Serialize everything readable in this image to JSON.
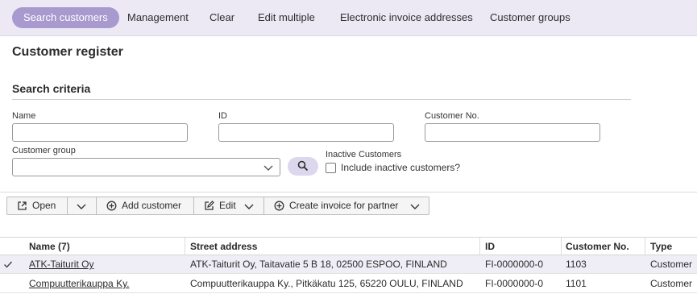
{
  "nav": {
    "tabs": [
      {
        "label": "Search customers",
        "active": true
      },
      {
        "label": "Management"
      },
      {
        "label": "Clear"
      },
      {
        "label": "Edit multiple"
      },
      {
        "label": "Electronic invoice addresses"
      },
      {
        "label": "Customer groups"
      }
    ]
  },
  "page": {
    "title": "Customer register"
  },
  "search": {
    "section_title": "Search criteria",
    "name_label": "Name",
    "name_value": "",
    "id_label": "ID",
    "id_value": "",
    "customer_no_label": "Customer No.",
    "customer_no_value": "",
    "customer_group_label": "Customer group",
    "customer_group_value": "",
    "inactive_label": "Inactive Customers",
    "include_inactive_label": "Include inactive customers?",
    "include_inactive_checked": false
  },
  "toolbar": {
    "open_label": "Open",
    "add_customer_label": "Add customer",
    "edit_label": "Edit",
    "create_invoice_label": "Create invoice for partner"
  },
  "table": {
    "columns": [
      "Name (7)",
      "Street address",
      "ID",
      "Customer No.",
      "Type"
    ],
    "rows": [
      {
        "name": "ATK-Taiturit Oy",
        "address": "ATK-Taiturit Oy, Taitavatie 5 B 18, 02500 ESPOO, FINLAND",
        "id": "FI-0000000-0",
        "customer_no": "1103",
        "type": "Customer",
        "selected": true
      },
      {
        "name": "Compuutterikauppa Ky.",
        "address": "Compuutterikauppa Ky., Pitkäkatu 125, 65220 OULU, FINLAND",
        "id": "FI-0000000-0",
        "customer_no": "1101",
        "type": "Customer",
        "selected": false
      }
    ]
  },
  "colors": {
    "accent": "#a899cf",
    "nav_bg": "#ece9f5",
    "selected_row": "#efedf6"
  }
}
